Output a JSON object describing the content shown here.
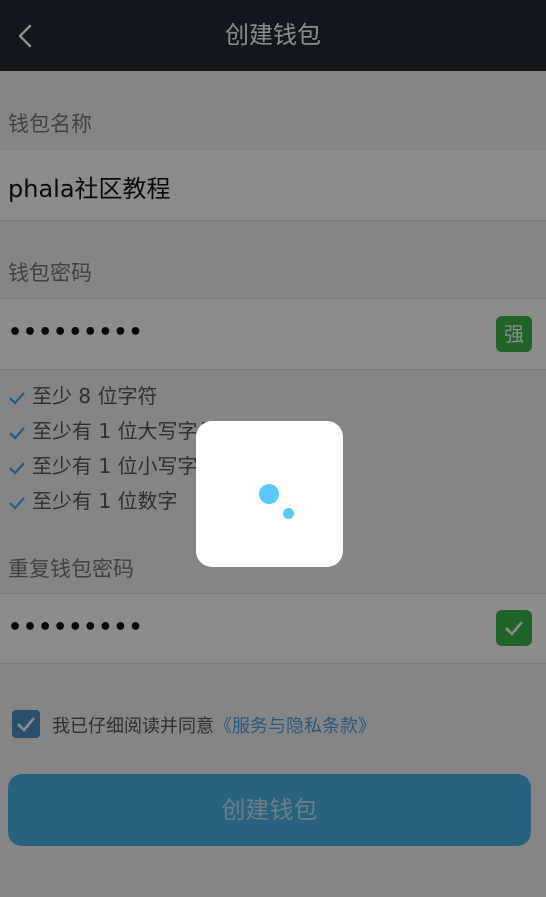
{
  "header": {
    "title": "创建钱包",
    "back_icon": "chevron-left-icon"
  },
  "wallet_name": {
    "label": "钱包名称",
    "value": "phala社区教程"
  },
  "wallet_password": {
    "label": "钱包密码",
    "value": "•••••••••",
    "strength_badge": "强"
  },
  "password_rules": [
    {
      "text": "至少 8 位字符"
    },
    {
      "text": "至少有 1 位大写字母"
    },
    {
      "text": "至少有 1 位小写字母"
    },
    {
      "text": "至少有 1 位数字"
    }
  ],
  "repeat_password": {
    "label": "重复钱包密码",
    "value": "•••••••••"
  },
  "agreement": {
    "text": "我已仔细阅读并同意",
    "link": "《服务与隐私条款》",
    "checked": true
  },
  "submit": {
    "label": "创建钱包"
  },
  "loading": {
    "icon": "loading-spinner-icon"
  }
}
